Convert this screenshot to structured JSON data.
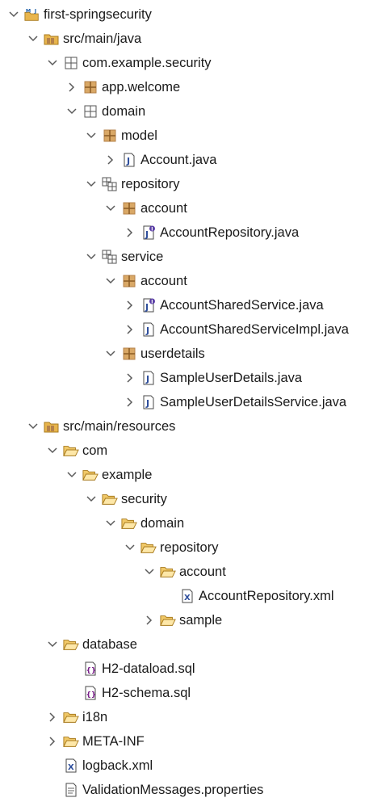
{
  "tree": {
    "nodes": [
      {
        "label": "first-springsecurity",
        "depth": 0,
        "twisty": "expanded",
        "icon": "project"
      },
      {
        "label": "src/main/java",
        "depth": 1,
        "twisty": "expanded",
        "icon": "source-folder"
      },
      {
        "label": "com.example.security",
        "depth": 2,
        "twisty": "expanded",
        "icon": "package-empty"
      },
      {
        "label": "app.welcome",
        "depth": 3,
        "twisty": "collapsed",
        "icon": "package"
      },
      {
        "label": "domain",
        "depth": 3,
        "twisty": "expanded",
        "icon": "package-empty"
      },
      {
        "label": "model",
        "depth": 4,
        "twisty": "expanded",
        "icon": "package"
      },
      {
        "label": "Account.java",
        "depth": 5,
        "twisty": "collapsed",
        "icon": "java-file"
      },
      {
        "label": "repository",
        "depth": 4,
        "twisty": "expanded",
        "icon": "package-group"
      },
      {
        "label": "account",
        "depth": 5,
        "twisty": "expanded",
        "icon": "package"
      },
      {
        "label": "AccountRepository.java",
        "depth": 6,
        "twisty": "collapsed",
        "icon": "java-interface"
      },
      {
        "label": "service",
        "depth": 4,
        "twisty": "expanded",
        "icon": "package-group"
      },
      {
        "label": "account",
        "depth": 5,
        "twisty": "expanded",
        "icon": "package"
      },
      {
        "label": "AccountSharedService.java",
        "depth": 6,
        "twisty": "collapsed",
        "icon": "java-interface"
      },
      {
        "label": "AccountSharedServiceImpl.java",
        "depth": 6,
        "twisty": "collapsed",
        "icon": "java-file"
      },
      {
        "label": "userdetails",
        "depth": 5,
        "twisty": "expanded",
        "icon": "package"
      },
      {
        "label": "SampleUserDetails.java",
        "depth": 6,
        "twisty": "collapsed",
        "icon": "java-file"
      },
      {
        "label": "SampleUserDetailsService.java",
        "depth": 6,
        "twisty": "collapsed",
        "icon": "java-file"
      },
      {
        "label": "src/main/resources",
        "depth": 1,
        "twisty": "expanded",
        "icon": "source-folder"
      },
      {
        "label": "com",
        "depth": 2,
        "twisty": "expanded",
        "icon": "folder-open"
      },
      {
        "label": "example",
        "depth": 3,
        "twisty": "expanded",
        "icon": "folder-open"
      },
      {
        "label": "security",
        "depth": 4,
        "twisty": "expanded",
        "icon": "folder-open"
      },
      {
        "label": "domain",
        "depth": 5,
        "twisty": "expanded",
        "icon": "folder-open"
      },
      {
        "label": "repository",
        "depth": 6,
        "twisty": "expanded",
        "icon": "folder-open"
      },
      {
        "label": "account",
        "depth": 7,
        "twisty": "expanded",
        "icon": "folder-open"
      },
      {
        "label": "AccountRepository.xml",
        "depth": 8,
        "twisty": "none",
        "icon": "xml-file"
      },
      {
        "label": "sample",
        "depth": 7,
        "twisty": "collapsed",
        "icon": "folder-open"
      },
      {
        "label": "database",
        "depth": 2,
        "twisty": "expanded",
        "icon": "folder-open"
      },
      {
        "label": "H2-dataload.sql",
        "depth": 3,
        "twisty": "none",
        "icon": "sql-file"
      },
      {
        "label": "H2-schema.sql",
        "depth": 3,
        "twisty": "none",
        "icon": "sql-file"
      },
      {
        "label": "i18n",
        "depth": 2,
        "twisty": "collapsed",
        "icon": "folder-open"
      },
      {
        "label": "META-INF",
        "depth": 2,
        "twisty": "collapsed",
        "icon": "folder-open"
      },
      {
        "label": "logback.xml",
        "depth": 2,
        "twisty": "none",
        "icon": "xml-file"
      },
      {
        "label": "ValidationMessages.properties",
        "depth": 2,
        "twisty": "none",
        "icon": "properties-file"
      }
    ]
  },
  "colors": {
    "text": "#1a1a1a",
    "twisty": "#5a5a5a",
    "folder": "#e8b54d",
    "folder_edge": "#a87a1c",
    "package": "#b5824a",
    "java_blue": "#2e4e9c",
    "background": "#ffffff"
  }
}
